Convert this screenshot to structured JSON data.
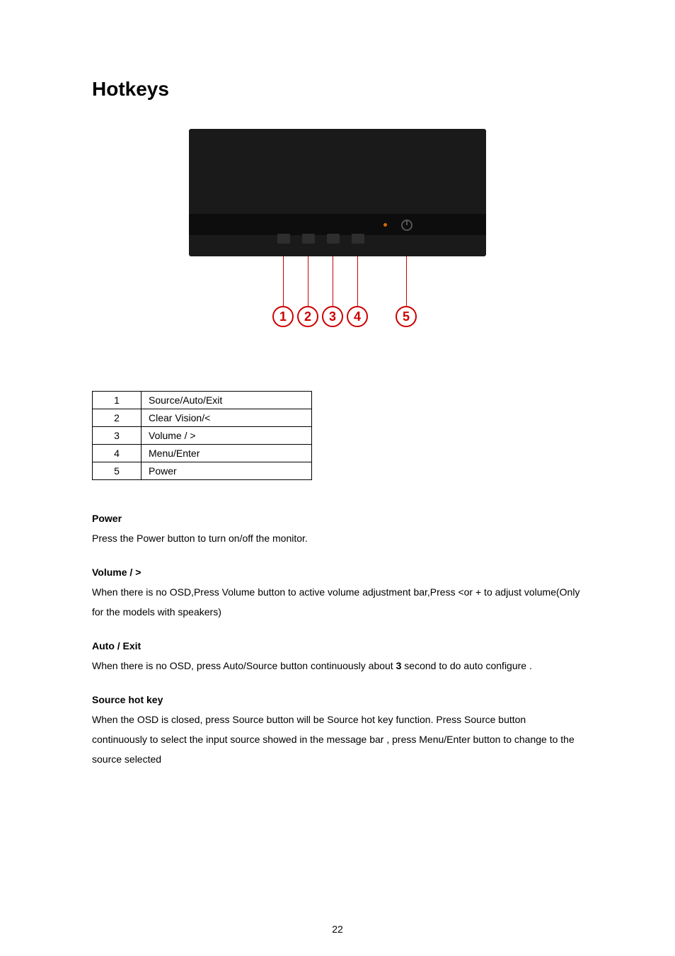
{
  "title": "Hotkeys",
  "callout_labels": {
    "1": "1",
    "2": "2",
    "3": "3",
    "4": "4",
    "5": "5"
  },
  "table": {
    "rows": [
      {
        "num": "1",
        "label": "Source/Auto/Exit"
      },
      {
        "num": "2",
        "label": "Clear Vision/<"
      },
      {
        "num": "3",
        "label": "Volume / >"
      },
      {
        "num": "4",
        "label": "Menu/Enter"
      },
      {
        "num": "5",
        "label": "Power"
      }
    ]
  },
  "sections": {
    "power": {
      "heading": "Power",
      "body": "Press the Power button to turn on/off the monitor."
    },
    "volume": {
      "heading": "Volume / >",
      "body": "When there is no OSD,Press Volume button to active volume adjustment bar,Press <or + to adjust volume(Only for the models with speakers)"
    },
    "auto": {
      "heading": "Auto / Exit",
      "body_pre": "When there is no OSD, press Auto/Source button continuously about ",
      "body_bold": "3",
      "body_post": " second   to do auto configure ."
    },
    "source": {
      "heading": "Source hot key",
      "body": "When the OSD is closed, press Source   button will be Source hot key function. Press Source button continuously to select the input source showed in the message bar , press Menu/Enter button to change to the source selected"
    }
  },
  "page_number": "22"
}
